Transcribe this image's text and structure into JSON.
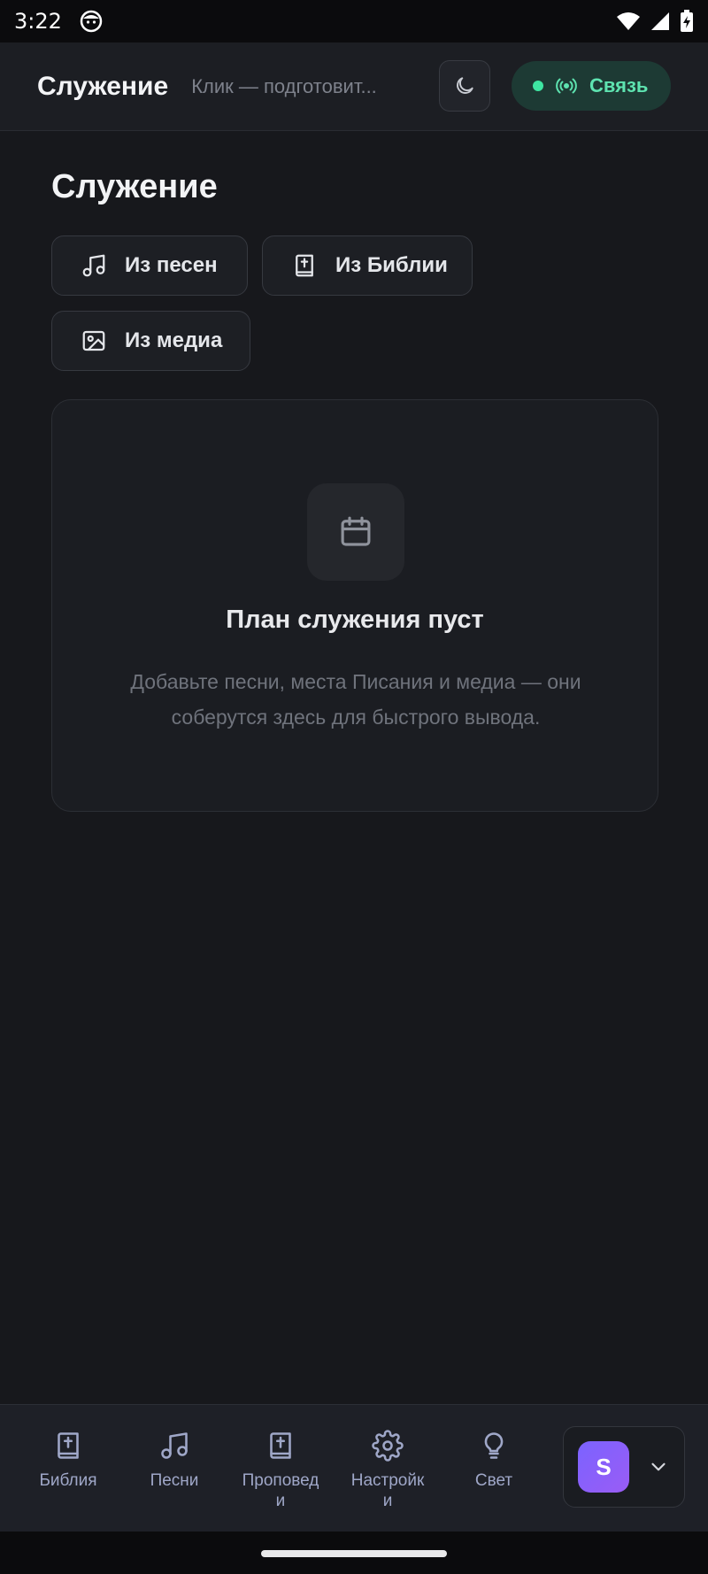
{
  "status_bar": {
    "time": "3:22",
    "icons": [
      "face-notification-icon",
      "wifi-icon",
      "signal-icon",
      "battery-charging-icon"
    ]
  },
  "app_bar": {
    "title": "Служение",
    "subtitle": "Клик — подготовит...",
    "theme_icon": "moon-icon",
    "connection_label": "Связь",
    "connection_status_color": "#3ee6a2"
  },
  "main": {
    "heading": "Служение",
    "add_buttons": [
      {
        "label": "Из песен",
        "icon": "music-note-icon"
      },
      {
        "label": "Из Библии",
        "icon": "bible-book-icon"
      },
      {
        "label": "Из медиа",
        "icon": "image-icon"
      }
    ],
    "empty_state": {
      "icon": "calendar-icon",
      "title": "План служения пуст",
      "description": "Добавьте песни, места Писания и медиа — они соберутся здесь для быстрого вывода."
    }
  },
  "bottom_nav": {
    "items": [
      {
        "label": "Библия",
        "icon": "bible-book-icon"
      },
      {
        "label": "Песни",
        "icon": "music-note-icon"
      },
      {
        "label": "Проповед\nи",
        "icon": "bible-book-icon"
      },
      {
        "label": "Настройк\nи",
        "icon": "gear-icon"
      },
      {
        "label": "Свет",
        "icon": "lightbulb-icon"
      }
    ],
    "user": {
      "initial": "S",
      "avatar_color": "#7b63ff"
    }
  },
  "colors": {
    "background": "#17181c",
    "accent_green": "#5ee3b0",
    "nav_icon": "#9fa7c8"
  }
}
